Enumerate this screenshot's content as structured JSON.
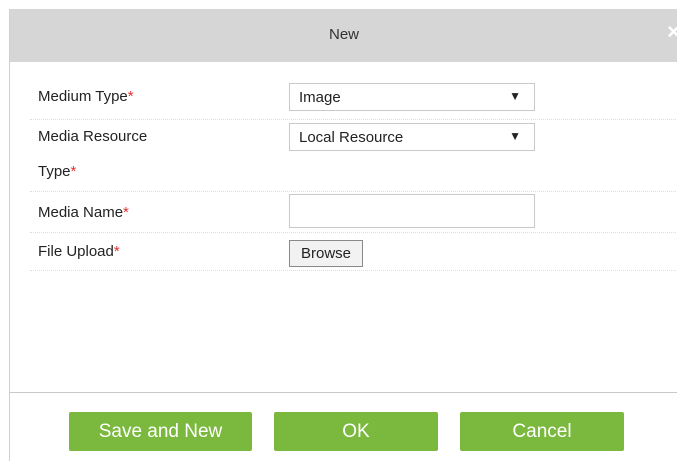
{
  "dialog": {
    "title": "New",
    "close_glyph": "×"
  },
  "form": {
    "medium_type": {
      "label": "Medium Type",
      "required": "*",
      "value": "Image",
      "arrow": "▼"
    },
    "media_resource_type": {
      "label_line1": "Media Resource",
      "label_line2": "Type",
      "required": "*",
      "value": "Local Resource",
      "arrow": "▼"
    },
    "media_name": {
      "label": "Media Name",
      "required": "*",
      "value": ""
    },
    "file_upload": {
      "label": "File Upload",
      "required": "*",
      "button": "Browse"
    }
  },
  "buttons": {
    "save_and_new": "Save and New",
    "ok": "OK",
    "cancel": "Cancel"
  },
  "colors": {
    "primary_button": "#7ab83e",
    "required_mark": "#e03030",
    "title_bar": "#d6d6d6"
  }
}
